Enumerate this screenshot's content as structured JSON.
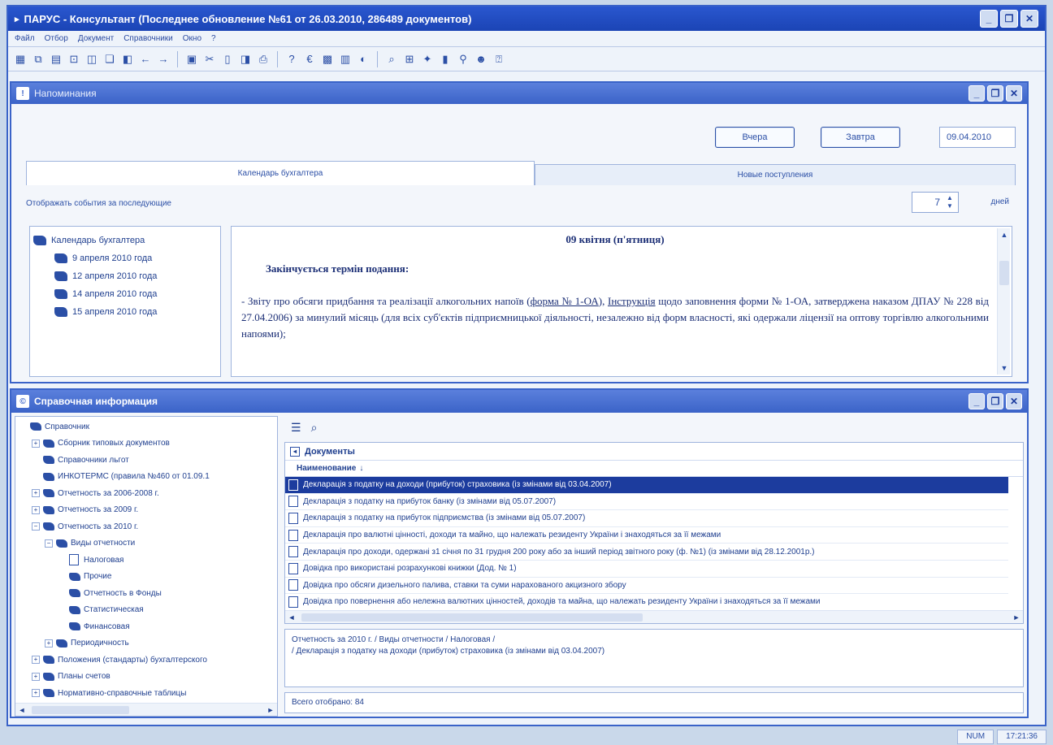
{
  "app": {
    "title": "ПАРУС - Консультант  (Последнее обновление №61 от 26.03.2010, 286489 документов)",
    "menu": [
      "Файл",
      "Отбор",
      "Документ",
      "Справочники",
      "Окно",
      "?"
    ]
  },
  "toolbar_icons": [
    "table-icon",
    "copy-icon",
    "paste-icon",
    "filter-icon",
    "bookmark-icon",
    "pages-icon",
    "note-icon",
    "back-icon",
    "forward-icon",
    "save-icon",
    "cut-icon",
    "doc-icon",
    "print-preview-icon",
    "print-icon",
    "help-icon",
    "euro-icon",
    "calc-icon",
    "calendar-icon",
    "globe-icon",
    "search-docs-icon",
    "tree-icon",
    "tools-icon",
    "info-icon",
    "find-icon",
    "user-icon",
    "question-icon"
  ],
  "reminder": {
    "title": "Напоминания",
    "yesterday": "Вчера",
    "tomorrow": "Завтра",
    "date": "09.04.2010",
    "tabs": [
      "Календарь бухгалтера",
      "Новые поступления"
    ],
    "events_label": "Отображать события за последующие",
    "days_value": "7",
    "days_unit": "дней",
    "tree": [
      "Календарь бухгалтера",
      "9 апреля 2010 года",
      "12 апреля 2010 года",
      "14 апреля 2010 года",
      "15 апреля 2010 года"
    ],
    "content": {
      "day": "09 квітня (п'ятниця)",
      "deadline": "Закінчується термін подання:",
      "para_start": "- Звіту про обсяги придбання та реалізації алкогольних напоїв (",
      "form_link": "форма № 1-ОА",
      "para_mid": "), ",
      "instr_link": "Інструкція",
      "para_end": " щодо заповнення форми № 1-ОА, затверджена наказом ДПАУ № 228 від 27.04.2006) за минулий місяць (для всіх суб'єктів підприємницької діяльності, незалежно від форм власності, які одержали ліцензії на оптову торгівлю алкогольними напоями);"
    }
  },
  "reference": {
    "title": "Справочная информация",
    "tree": [
      {
        "label": "Справочник",
        "level": 0,
        "expander": "",
        "icon": "book"
      },
      {
        "label": "Сборник типовых документов",
        "level": 1,
        "expander": "+",
        "icon": "book"
      },
      {
        "label": "Справочники льгот",
        "level": 1,
        "expander": "",
        "icon": "book"
      },
      {
        "label": "ИНКОТЕРМС (правила №460 от 01.09.1",
        "level": 1,
        "expander": "",
        "icon": "book"
      },
      {
        "label": "Отчетность за 2006-2008 г.",
        "level": 1,
        "expander": "+",
        "icon": "book"
      },
      {
        "label": "Отчетность за 2009 г.",
        "level": 1,
        "expander": "+",
        "icon": "book"
      },
      {
        "label": "Отчетность за 2010 г.",
        "level": 1,
        "expander": "−",
        "icon": "book"
      },
      {
        "label": "Виды отчетности",
        "level": 2,
        "expander": "−",
        "icon": "book"
      },
      {
        "label": "Налоговая",
        "level": 3,
        "expander": "",
        "icon": "page"
      },
      {
        "label": "Прочие",
        "level": 3,
        "expander": "",
        "icon": "book"
      },
      {
        "label": "Отчетность в Фонды",
        "level": 3,
        "expander": "",
        "icon": "book"
      },
      {
        "label": "Статистическая",
        "level": 3,
        "expander": "",
        "icon": "book"
      },
      {
        "label": "Финансовая",
        "level": 3,
        "expander": "",
        "icon": "book"
      },
      {
        "label": "Периодичность",
        "level": 2,
        "expander": "+",
        "icon": "book"
      },
      {
        "label": "Положения (стандарты) бухгалтерского",
        "level": 1,
        "expander": "+",
        "icon": "book"
      },
      {
        "label": "Планы счетов",
        "level": 1,
        "expander": "+",
        "icon": "book"
      },
      {
        "label": "Нормативно-справочные таблицы",
        "level": 1,
        "expander": "+",
        "icon": "book"
      }
    ],
    "documents_header": "Документы",
    "column": "Наименование",
    "documents": [
      "Декларація з податку на доходи (прибуток) страховика (із змінами від 03.04.2007)",
      "Декларація з податку на прибуток банку (із змінами від 05.07.2007)",
      "Декларація з податку на прибуток підприємства (із змінами від 05.07.2007)",
      "Декларація про валютні цінності, доходи та майно, що належать резиденту України і знаходяться за її межами",
      "Декларація про доходи, одержані з1 січня по 31 грудня 200 року або за інший період звітного року (ф. №1) (із змінами від 28.12.2001р.)",
      "Довідка про використані розрахункові книжки (Дод. № 1)",
      "Довідка про обсяги дизельного палива, ставки та суми нарахованого акцизного збору",
      "Довідка про повернення або нележна валютних цінностей, доходів та майна, що належать резиденту України і знаходяться за її межами"
    ],
    "path_line1": "Отчетность за 2010 г. / Виды отчетности / Налоговая /",
    "path_line2": "/ Декларація з податку на доходи (прибуток) страховика (із змінами від 03.04.2007)",
    "total": "Всего отобрано: 84"
  },
  "status": {
    "num": "NUM",
    "time": "17:21:36"
  }
}
